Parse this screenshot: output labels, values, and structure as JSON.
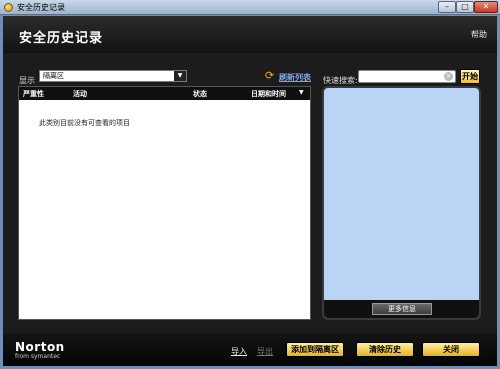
{
  "window": {
    "title": "安全历史记录"
  },
  "header": {
    "heading": "安全历史记录",
    "help": "帮助"
  },
  "filter": {
    "show_label": "显示",
    "selected": "隔离区"
  },
  "refresh": {
    "label": "刷新列表"
  },
  "table": {
    "columns": [
      "严重性",
      "活动",
      "状态",
      "日期和时间"
    ],
    "empty_message": "此类别目前没有可查看的项目"
  },
  "search": {
    "label": "快速搜索:",
    "value": "",
    "placeholder": "",
    "go_label": "开始"
  },
  "details": {
    "more_label": "更多信息"
  },
  "footer": {
    "brand": "Norton",
    "brand_sub": "from symantec",
    "import": "导入",
    "export": "导出",
    "add_to_quarantine": "添加到隔离区",
    "clear_history": "清除历史",
    "close": "关闭"
  },
  "colors": {
    "accent": "#f1c03a",
    "panel": "#b9d4f5",
    "chrome": "#1c1c1c"
  },
  "icons": [
    "app-icon",
    "chevron-down-icon",
    "refresh-icon",
    "sort-down-icon",
    "clear-icon"
  ]
}
